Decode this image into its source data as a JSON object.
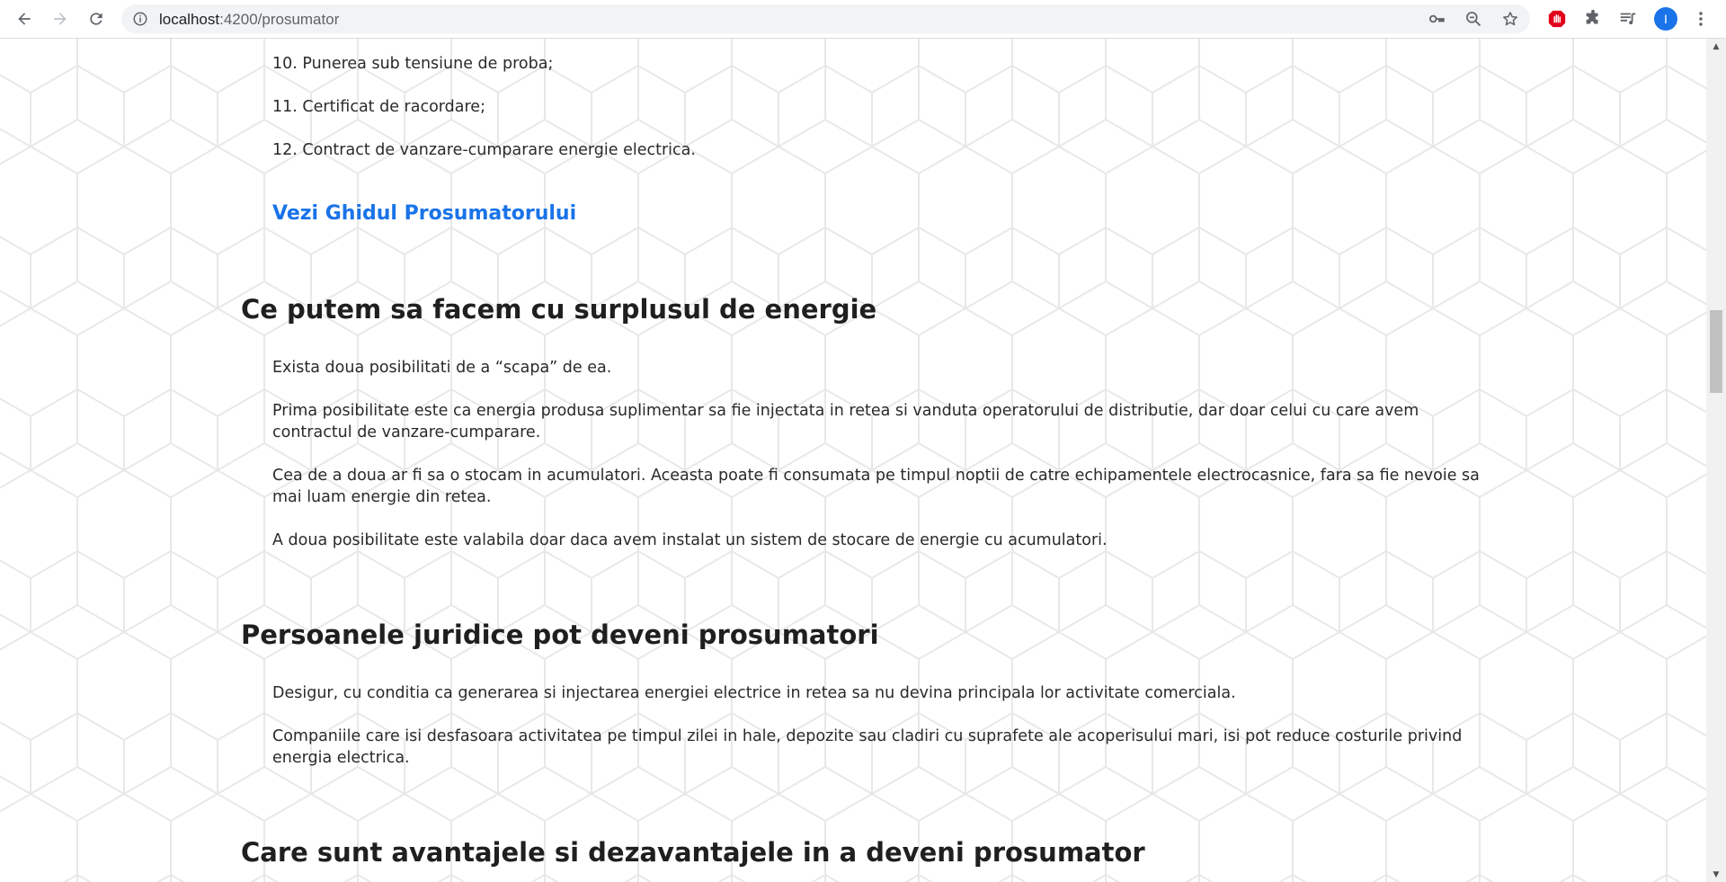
{
  "browser": {
    "url_host": "localhost",
    "url_path": ":4200/prosumator",
    "avatar_letter": "I"
  },
  "icons": {
    "back": "back-arrow-icon",
    "forward": "forward-arrow-icon",
    "reload": "reload-icon",
    "site_info": "info-icon",
    "key": "key-icon",
    "zoom": "zoom-out-icon",
    "bookmark": "star-icon",
    "adblock": "stop-hand-icon",
    "extensions": "puzzle-icon",
    "media": "playlist-icon",
    "menu": "kebab-menu-icon"
  },
  "colors": {
    "link": "#1a73e8",
    "heading": "#1f1f1f",
    "text": "#2a2a2a",
    "adblock": "#e3001b",
    "avatar": "#1a73e8"
  },
  "steps": {
    "item10": "10. Punerea sub tensiune de proba;",
    "item11": "11. Certificat de racordare;",
    "item12": "12. Contract de vanzare-cumparare energie electrica.",
    "guide_link": "Vezi Ghidul Prosumatorului"
  },
  "section_surplus": {
    "title": "Ce putem sa facem cu surplusul de energie",
    "p1": "Exista doua posibilitati de a “scapa” de ea.",
    "p2": "Prima posibilitate este ca energia produsa suplimentar sa fie injectata in retea si vanduta operatorului de distributie, dar doar celui cu care avem contractul de vanzare-cumparare.",
    "p3": "Cea de a doua ar fi sa o stocam in acumulatori. Aceasta poate fi consumata pe timpul noptii de catre echipamentele electrocasnice, fara sa fie nevoie sa mai luam energie din retea.",
    "p4": "A doua posibilitate este valabila doar daca avem instalat un sistem de stocare de energie cu acumulatori."
  },
  "section_juridice": {
    "title": "Persoanele juridice pot deveni prosumatori",
    "p1": "Desigur, cu conditia ca generarea si injectarea energiei electrice in retea sa nu devina principala lor activitate comerciala.",
    "p2": "Companiile care isi desfasoara activitatea pe timpul zilei in hale, depozite sau cladiri cu suprafete ale acoperisului mari, isi pot reduce costurile privind energia electrica."
  },
  "section_avantaje": {
    "title": "Care sunt avantajele si dezavantajele in a deveni prosumator"
  }
}
